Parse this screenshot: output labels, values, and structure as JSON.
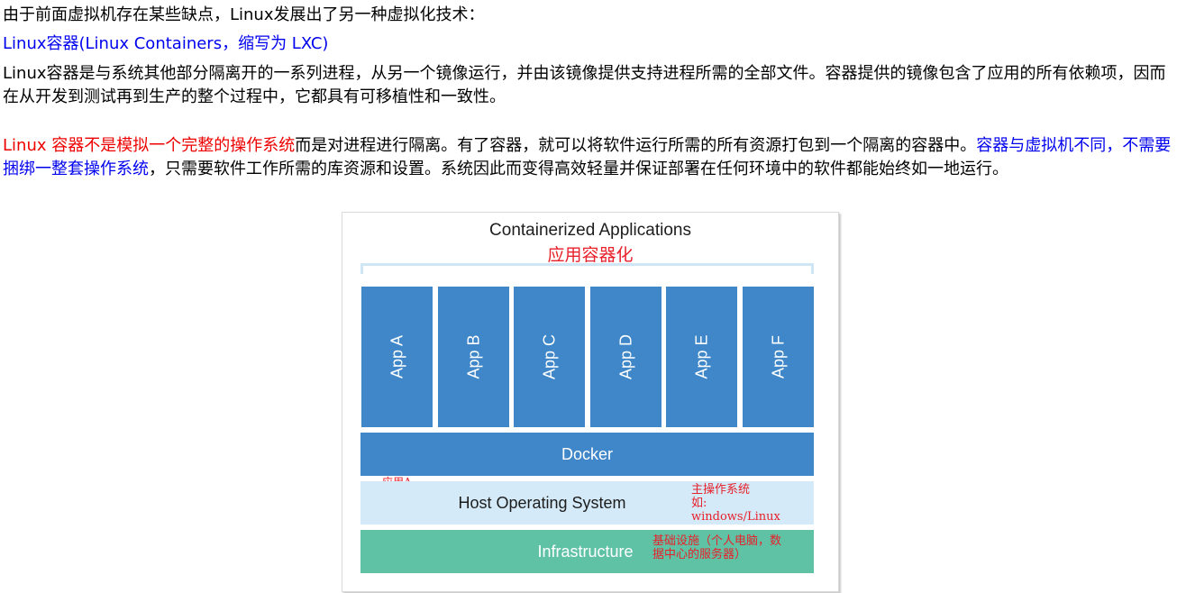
{
  "text": {
    "line1": "由于前面虚拟机存在某些缺点，Linux发展出了另一种虚拟化技术：",
    "line2": "Linux容器(Linux Containers，缩写为 LXC)",
    "para1": "Linux容器是与系统其他部分隔离开的一系列进程，从另一个镜像运行，并由该镜像提供支持进程所需的全部文件。容器提供的镜像包含了应用的所有依赖项，因而在从开发到测试再到生产的整个过程中，它都具有可移植性和一致性。",
    "para2_red": "Linux 容器不是模拟一个完整的操作系统",
    "para2_black1": "而是对进程进行隔离。有了容器，就可以将软件运行所需的所有资源打包到一个隔离的容器中。",
    "para2_blue": "容器与虚拟机不同，不需要捆绑一整套操作系统",
    "para2_black2": "，只需要软件工作所需的库资源和设置。系统因此而变得高效轻量并保证部署在任何环境中的软件都能始终如一地运行。"
  },
  "figure": {
    "title": "Containerized Applications",
    "subtitle": "应用容器化",
    "apps": [
      "App A",
      "App B",
      "App C",
      "App D",
      "App E",
      "App F"
    ],
    "app_a_note": "应用A",
    "docker": "Docker",
    "host": "Host Operating System",
    "host_note_line1": "主操作系统",
    "host_note_line2": "如:",
    "host_note_line3": "windows/Linux",
    "infra": "Infrastructure",
    "infra_note_line1": "基础设施（个人电脑，数",
    "infra_note_line2": "据中心的服务器）",
    "colors": {
      "app_blue": "#3f87c8",
      "host_light_blue": "#d4eaf8",
      "infra_green": "#5fc2a5",
      "annotation_red": "#e8202a"
    }
  }
}
